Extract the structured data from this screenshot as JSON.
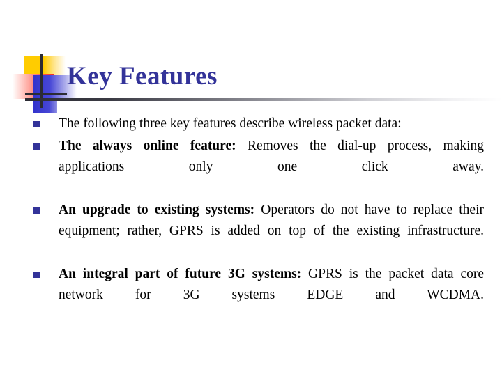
{
  "slide": {
    "title": "Key Features",
    "title_color": "#333399",
    "bullet_color": "#333399",
    "background_color": "#ffffff",
    "body_text_color": "#000000",
    "decor": {
      "yellow": "#ffcc00",
      "red": "#f22d20",
      "blue": "#3333cc",
      "line": "#2b2b33"
    },
    "bullets": [
      {
        "lead": "",
        "text": "The following three key features describe wireless packet data:",
        "justified": false
      },
      {
        "lead": "The always online feature:",
        "text": " Removes the dial-up process, making applications only one click away.",
        "justified": true
      },
      {
        "lead": "An upgrade to existing systems:",
        "text": " Operators do not have to replace their equipment; rather, GPRS is added on top of the existing infrastructure.",
        "justified": true
      },
      {
        "lead": "An integral part of future 3G systems:",
        "text": " GPRS is the packet data core network for 3G systems EDGE and WCDMA.",
        "justified": true
      }
    ]
  }
}
